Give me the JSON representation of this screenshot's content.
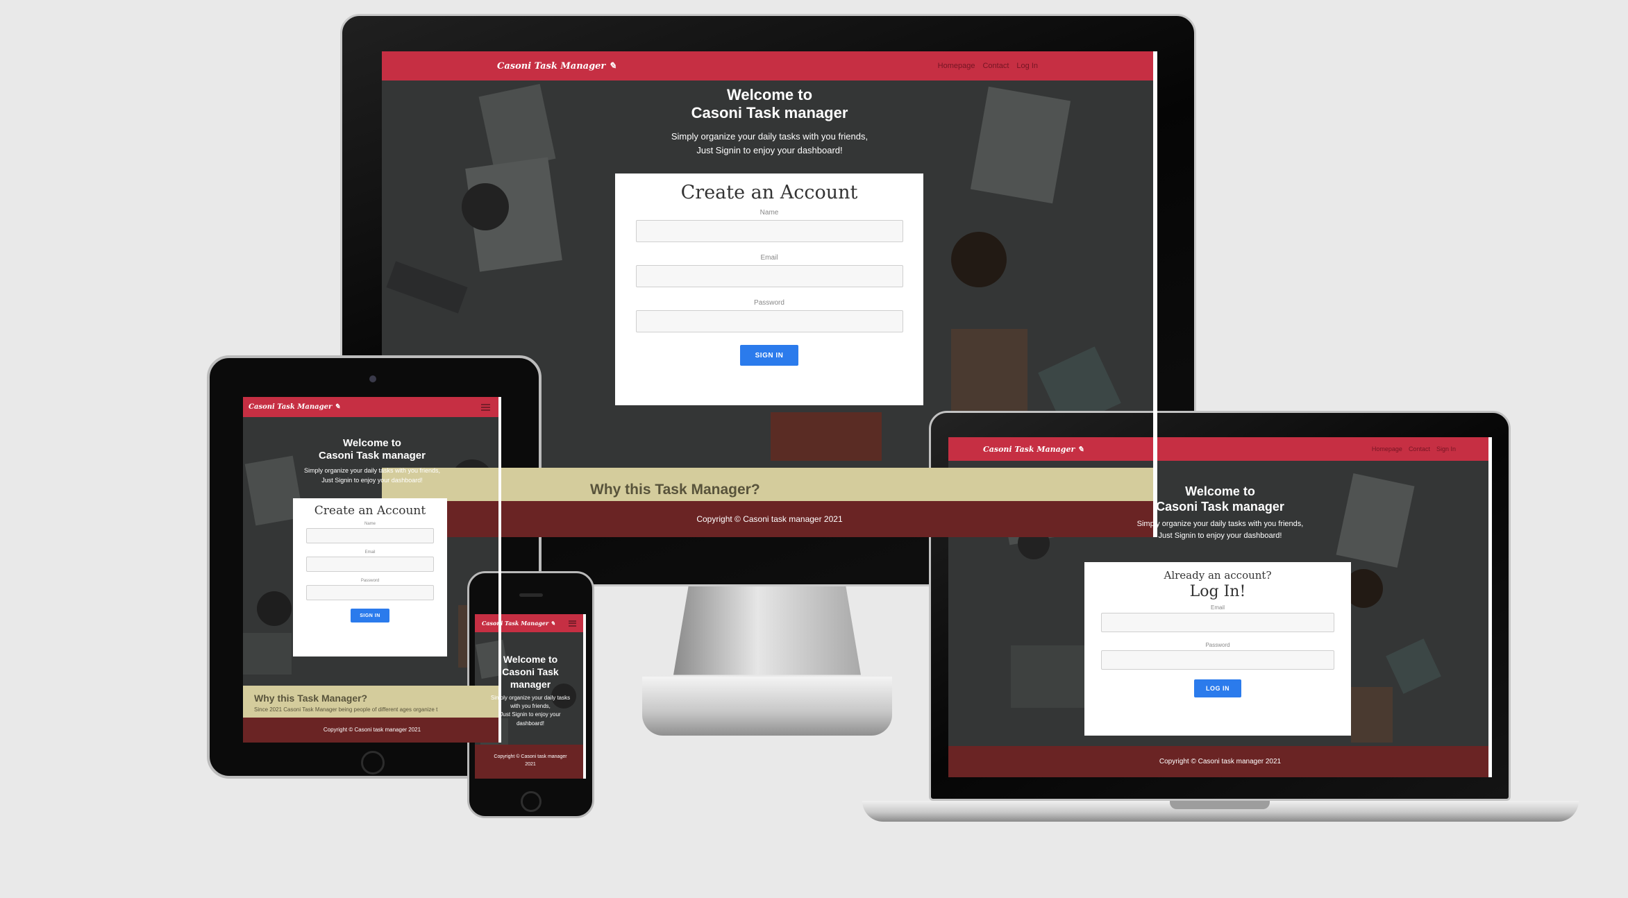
{
  "site": {
    "brand": "Casoni Task Manager",
    "brand_icon": "feather-icon",
    "nav_links": [
      "Homepage",
      "Contact",
      "Log In"
    ],
    "laptop_nav_links": [
      "Homepage",
      "Contact",
      "Sign In"
    ],
    "hero_title_line1": "Welcome to",
    "hero_title_line2": "Casoni Task manager",
    "hero_sub_line1": "Simply organize your daily tasks with you friends,",
    "hero_sub_line2": "Just Signin to enjoy your dashboard!",
    "phone_title_line1": "Welcome to",
    "phone_title_line2": "Casoni Task",
    "phone_title_line3": "manager",
    "phone_sub_line1": "Simply organize your daily tasks",
    "phone_sub_line2": "with you friends,",
    "phone_sub_line3": "Just Signin to enjoy your",
    "phone_sub_line4": "dashboard!",
    "why_heading": "Why this Task Manager?",
    "why_text": "Since 2021 Casoni Task Manager being people of different ages organize t",
    "footer": "Copyright © Casoni task manager 2021",
    "phone_footer_line1": "Copyright © Casoni task manager",
    "phone_footer_line2": "2021"
  },
  "signup_form": {
    "title": "Create an Account",
    "name_label": "Name",
    "email_label": "Email",
    "password_label": "Password",
    "name_value": "",
    "email_value": "",
    "password_value": "",
    "submit": "SIGN IN"
  },
  "login_form": {
    "pretitle": "Already an account?",
    "title": "Log In!",
    "email_label": "Email",
    "password_label": "Password",
    "email_value": "",
    "password_value": "",
    "submit": "LOG IN"
  },
  "colors": {
    "navbar": "#c62f43",
    "button": "#2b7bec",
    "why_band": "#d4cc9c",
    "footer": "#6a2424",
    "background": "#e9e9e9"
  }
}
